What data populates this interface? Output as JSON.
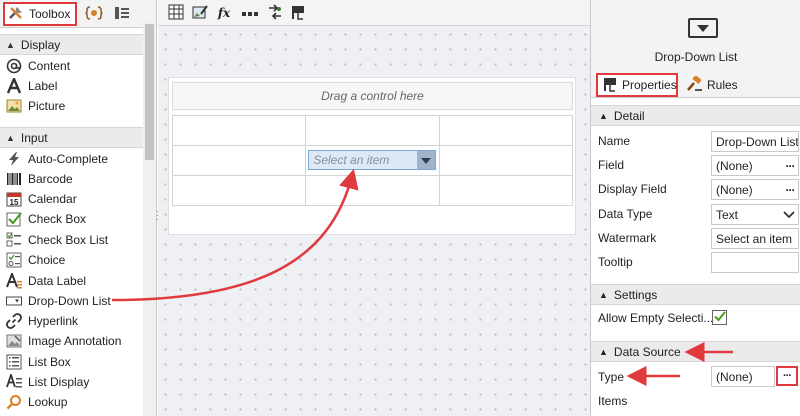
{
  "toolbox": {
    "tab_label": "Toolbox",
    "categories": {
      "display": "Display",
      "input": "Input"
    },
    "display_items": [
      "Content",
      "Label",
      "Picture"
    ],
    "input_items": [
      "Auto-Complete",
      "Barcode",
      "Calendar",
      "Check Box",
      "Check Box List",
      "Choice",
      "Data Label",
      "Drop-Down List",
      "Hyperlink",
      "Image Annotation",
      "List Box",
      "List Display",
      "Lookup"
    ],
    "calendar_icon_number": "15"
  },
  "canvas": {
    "drop_hint": "Drag a control here",
    "dropdown_placeholder": "Select an item",
    "toolbar_fx": "fx"
  },
  "properties": {
    "control_title": "Drop-Down List",
    "tabs": {
      "properties": "Properties",
      "rules": "Rules"
    },
    "sections": {
      "detail": "Detail",
      "settings": "Settings",
      "data_source": "Data Source"
    },
    "detail": {
      "name_label": "Name",
      "name_value": "Drop-Down List",
      "field_label": "Field",
      "field_value": "(None)",
      "display_field_label": "Display Field",
      "display_field_value": "(None)",
      "data_type_label": "Data Type",
      "data_type_value": "Text",
      "watermark_label": "Watermark",
      "watermark_value": "Select an item",
      "tooltip_label": "Tooltip",
      "tooltip_value": ""
    },
    "settings": {
      "allow_empty_label": "Allow Empty Selecti...",
      "allow_empty_checked": true
    },
    "data_source": {
      "type_label": "Type",
      "type_value": "(None)",
      "items_label": "Items"
    },
    "ellipsis": "···"
  },
  "colors": {
    "highlight": "#e0393e",
    "accent_blue": "#7aa7d6",
    "section_bg": "#ebebeb"
  }
}
